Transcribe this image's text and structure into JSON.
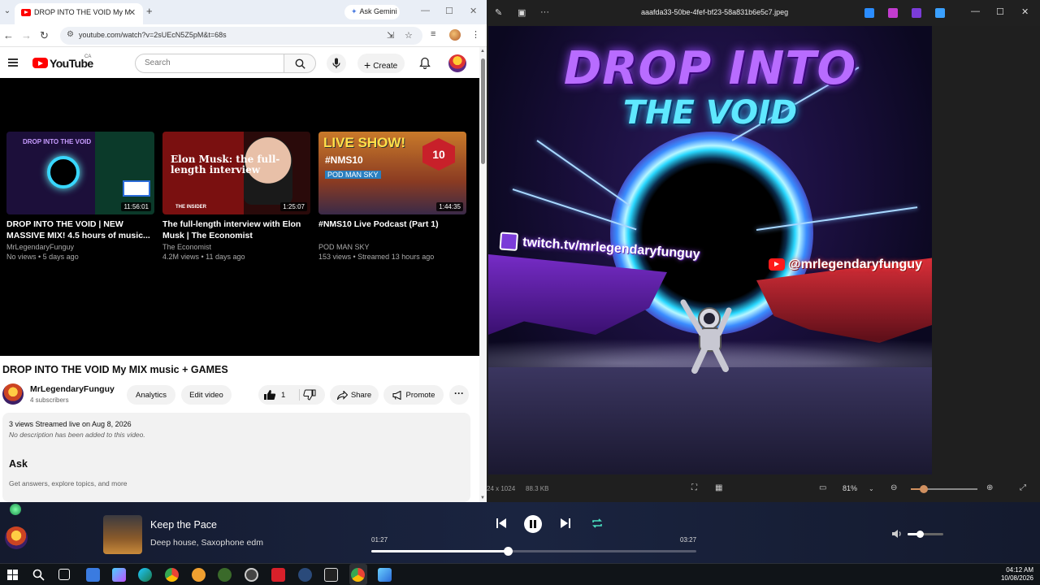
{
  "browser": {
    "tab_title": "DROP INTO THE VOID My MIX music",
    "gemini_label": "Ask Gemini",
    "url": "youtube.com/watch?v=2sUEcN5Z5pM&t=68s"
  },
  "youtube": {
    "logo_text": "YouTube",
    "country": "CA",
    "search_placeholder": "Search",
    "create_label": "Create",
    "related": [
      {
        "title": "DROP INTO THE VOID | NEW MASSIVE MIX! 4.5 hours of music...",
        "channel": "MrLegendaryFunguy",
        "meta": "No views • 5 days ago",
        "duration": "11:56:01",
        "thumb_text": "DROP INTO THE VOID"
      },
      {
        "title": "The full-length interview with Elon Musk | The Economist",
        "channel": "The Economist",
        "meta": "4.2M views • 11 days ago",
        "duration": "1:25:07",
        "thumb_text": "Elon Musk: the full-length interview",
        "thumb_source": "THE INSIDER"
      },
      {
        "title": "#NMS10 Live Podcast (Part 1)",
        "channel": "POD MAN SKY",
        "meta": "153 views • Streamed 13 hours ago",
        "duration": "1:44:35",
        "thumb_live": "LIVE SHOW!",
        "thumb_tag": "#NMS10",
        "thumb_badge": "10",
        "thumb_pod": "POD MAN SKY"
      }
    ],
    "video_title": "DROP INTO THE VOID My MIX music + GAMES",
    "channel_name": "MrLegendaryFunguy",
    "subscribers": "4 subscribers",
    "analytics_label": "Analytics",
    "edit_label": "Edit video",
    "like_count": "1",
    "share_label": "Share",
    "promote_label": "Promote",
    "stats": "3 views  Streamed live on Aug 8, 2026",
    "no_description": "No description has been added to this video.",
    "ask_heading": "Ask",
    "ask_sub": "Get answers, explore topics, and more"
  },
  "viewer": {
    "file_name": "aaafda33-50be-4fef-bf23-58a831b6e5c7.jpeg",
    "dimensions": "24 x 1024",
    "file_size": "88.3 KB",
    "zoom": "81%",
    "zoom_level": 0.2,
    "art": {
      "title_line1": "DROP INTO",
      "title_line2": "THE VOID",
      "twitch": "twitch.tv/mrlegendaryfunguy",
      "youtube_handle": "@mrlegendaryfunguy"
    }
  },
  "media": {
    "song": "Keep the Pace",
    "artist": "Deep house, Saxophone edm",
    "current_time": "01:27",
    "total_time": "03:27",
    "progress": 0.42,
    "volume": 0.35
  },
  "taskbar": {
    "time": "04:12 AM",
    "date": "10/08/2026"
  },
  "colors": {
    "youtube_red": "#ff0000",
    "media_bg": "#1a2440",
    "accent_cyan": "#5fe8ff",
    "accent_purple": "#b86cff"
  }
}
